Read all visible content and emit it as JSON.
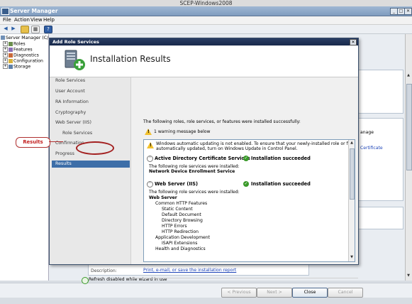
{
  "vm_title": "SCEP-Windows2008",
  "server_manager": {
    "title": "Server Manager",
    "menu": [
      "File",
      "Action",
      "View",
      "Help"
    ],
    "tree": [
      {
        "label": "Server Manager (C/",
        "level": 0
      },
      {
        "label": "Roles",
        "level": 1
      },
      {
        "label": "Features",
        "level": 1
      },
      {
        "label": "Diagnostics",
        "level": 1
      },
      {
        "label": "Configuration",
        "level": 1
      },
      {
        "label": "Storage",
        "level": 1
      }
    ],
    "right_snippets": {
      "manage": "anage",
      "certificate": "Certificate"
    },
    "description_label": "Description:",
    "status_text": "Refresh disabled while wizard in use"
  },
  "wizard": {
    "title": "Add Role Services",
    "heading": "Installation Results",
    "nav": [
      {
        "label": "Role Services",
        "state": "done",
        "sub": false
      },
      {
        "label": "User Account",
        "state": "done",
        "sub": false
      },
      {
        "label": "RA Information",
        "state": "done",
        "sub": false
      },
      {
        "label": "Cryptography",
        "state": "done",
        "sub": false
      },
      {
        "label": "Web Server (IIS)",
        "state": "done",
        "sub": false
      },
      {
        "label": "Role Services",
        "state": "done",
        "sub": true
      },
      {
        "label": "Confirmation",
        "state": "done",
        "sub": false
      },
      {
        "label": "Progress",
        "state": "done",
        "sub": false
      },
      {
        "label": "Results",
        "state": "current",
        "sub": false
      }
    ],
    "intro": "The following roles, role services, or features were installed successfully:",
    "warning_summary": "1 warning message below",
    "warning_text_1": "Windows automatic updating is not enabled. To ensure that your newly-installed role or feature is",
    "warning_text_2": "automatically updated, turn on Windows Update in Control Panel.",
    "sections": [
      {
        "name": "Active Directory Certificate Services",
        "status": "Installation succeeded",
        "lines": [
          "The following role services were installed:"
        ],
        "bold_lines": [
          "Network Device Enrollment Service"
        ]
      },
      {
        "name": "Web Server (IIS)",
        "status": "Installation succeeded",
        "lines": [
          "The following role services were installed:"
        ],
        "bold_lines": [
          "Web Server"
        ]
      }
    ],
    "iis_tree": [
      {
        "label": "Common HTTP Features",
        "indent": 1
      },
      {
        "label": "Static Content",
        "indent": 2
      },
      {
        "label": "Default Document",
        "indent": 2
      },
      {
        "label": "Directory Browsing",
        "indent": 2
      },
      {
        "label": "HTTP Errors",
        "indent": 2
      },
      {
        "label": "HTTP Redirection",
        "indent": 2
      },
      {
        "label": "Application Development",
        "indent": 1
      },
      {
        "label": "ISAPI Extensions",
        "indent": 2
      },
      {
        "label": "Health and Diagnostics",
        "indent": 1
      }
    ],
    "print_link": "Print, e-mail, or save the installation report",
    "buttons": {
      "previous": "< Previous",
      "next": "Next >",
      "close": "Close",
      "cancel": "Cancel"
    }
  },
  "callout": {
    "label": "Results"
  },
  "colors": {
    "nav_selected": "#3d6ea8",
    "callout": "#b03030",
    "link": "#1d44b8",
    "success": "#3a9a2a",
    "warning": "#f2c12e"
  }
}
